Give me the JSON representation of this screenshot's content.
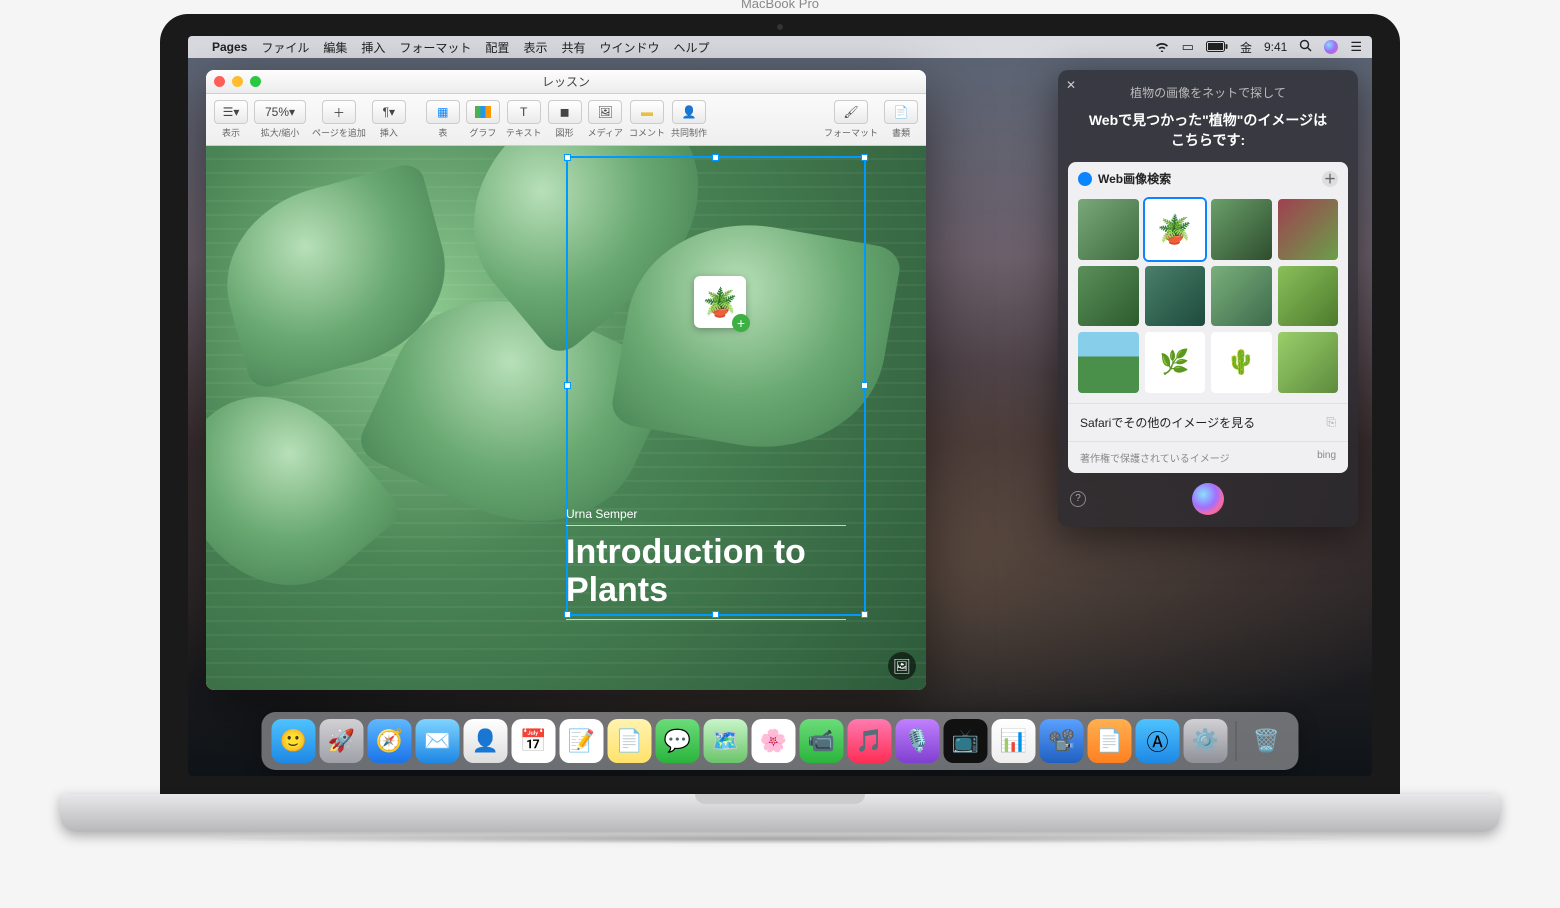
{
  "menubar": {
    "app": "Pages",
    "items": [
      "ファイル",
      "編集",
      "挿入",
      "フォーマット",
      "配置",
      "表示",
      "共有",
      "ウインドウ",
      "ヘルプ"
    ],
    "day": "金",
    "time": "9:41"
  },
  "window": {
    "title": "レッスン",
    "toolbar": {
      "view": "表示",
      "zoom_value": "75%",
      "zoom": "拡大/縮小",
      "addpage": "ページを追加",
      "insert": "挿入",
      "table": "表",
      "chart": "グラフ",
      "text": "テキスト",
      "shape": "図形",
      "media": "メディア",
      "comment": "コメント",
      "collab": "共同制作",
      "format": "フォーマット",
      "document": "書類"
    },
    "doc": {
      "author": "Urna Semper",
      "title": "Introduction to Plants"
    }
  },
  "siri": {
    "query": "植物の画像をネットで探して",
    "response": "Webで見つかった\"植物\"のイメージはこちらです:",
    "card_title": "Web画像検索",
    "safari_link": "Safariでその他のイメージを見る",
    "copyright": "著作権で保護されているイメージ",
    "provider": "bing"
  },
  "laptop": {
    "brand": "MacBook Pro"
  },
  "dock": {
    "icons": [
      {
        "name": "finder",
        "bg": "linear-gradient(#4ec3ff,#1e88e5)",
        "glyph": "🙂"
      },
      {
        "name": "launchpad",
        "bg": "linear-gradient(#d0d0d5,#a0a0a8)",
        "glyph": "🚀"
      },
      {
        "name": "safari",
        "bg": "linear-gradient(#60b8ff,#1a73e8)",
        "glyph": "🧭"
      },
      {
        "name": "mail",
        "bg": "linear-gradient(#7fd3ff,#1e88e5)",
        "glyph": "✉️"
      },
      {
        "name": "contacts",
        "bg": "linear-gradient(#fff,#ddd)",
        "glyph": "👤"
      },
      {
        "name": "calendar",
        "bg": "#fff",
        "glyph": "📅"
      },
      {
        "name": "reminders",
        "bg": "#fff",
        "glyph": "📝"
      },
      {
        "name": "notes",
        "bg": "linear-gradient(#fff3b0,#ffe26b)",
        "glyph": "📄"
      },
      {
        "name": "messages",
        "bg": "linear-gradient(#6bdc7a,#2ab43c)",
        "glyph": "💬"
      },
      {
        "name": "maps",
        "bg": "linear-gradient(#c8f5c8,#6bc46b)",
        "glyph": "🗺️"
      },
      {
        "name": "photos",
        "bg": "#fff",
        "glyph": "🌸"
      },
      {
        "name": "facetime",
        "bg": "linear-gradient(#6bdc7a,#2ab43c)",
        "glyph": "📹"
      },
      {
        "name": "music",
        "bg": "linear-gradient(#ff7ab0,#ff2d55)",
        "glyph": "🎵"
      },
      {
        "name": "podcasts",
        "bg": "linear-gradient(#c080ff,#8040d0)",
        "glyph": "🎙️"
      },
      {
        "name": "tv",
        "bg": "#111",
        "glyph": "📺"
      },
      {
        "name": "numbers",
        "bg": "linear-gradient(#fff,#eee)",
        "glyph": "📊"
      },
      {
        "name": "keynote",
        "bg": "linear-gradient(#5aa0ff,#2060c0)",
        "glyph": "📽️"
      },
      {
        "name": "pages",
        "bg": "linear-gradient(#ffb050,#ff8020)",
        "glyph": "📄"
      },
      {
        "name": "appstore",
        "bg": "linear-gradient(#4ec3ff,#1e88e5)",
        "glyph": "Ⓐ"
      },
      {
        "name": "settings",
        "bg": "linear-gradient(#d0d0d5,#909098)",
        "glyph": "⚙️"
      }
    ],
    "trash": {
      "name": "trash",
      "glyph": "🗑️"
    }
  }
}
